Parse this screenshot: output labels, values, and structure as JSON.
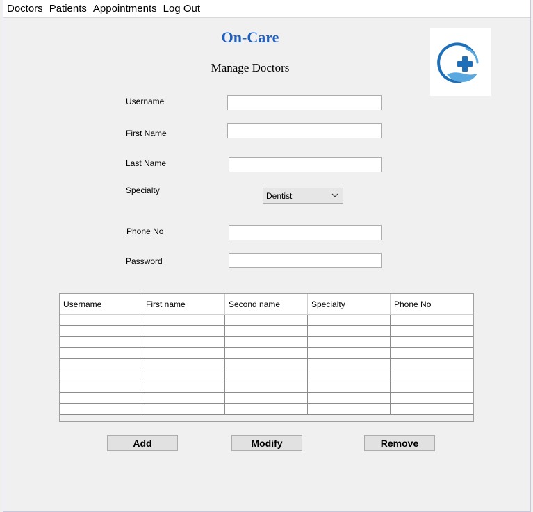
{
  "menu": {
    "items": [
      {
        "label": "Doctors"
      },
      {
        "label": "Patients"
      },
      {
        "label": "Appointments"
      },
      {
        "label": "Log Out"
      }
    ]
  },
  "header": {
    "app_title": "On-Care",
    "page_title": "Manage Doctors"
  },
  "form": {
    "username_label": "Username",
    "username_value": "",
    "first_name_label": "First Name",
    "first_name_value": "",
    "last_name_label": "Last Name",
    "last_name_value": "",
    "specialty_label": "Specialty",
    "specialty_selected": "Dentist",
    "phone_label": "Phone No",
    "phone_value": "",
    "password_label": "Password",
    "password_value": ""
  },
  "table": {
    "columns": [
      "Username",
      "First name",
      "Second name",
      "Specialty",
      "Phone No"
    ],
    "rows": []
  },
  "buttons": {
    "add_label": "Add",
    "modify_label": "Modify",
    "remove_label": "Remove"
  },
  "colors": {
    "app_title": "#1f5fbf",
    "logo_blue": "#1f6fb8",
    "logo_light_blue": "#5aa8e0"
  },
  "icons": {
    "logo": "medical-cross-hand-icon",
    "dropdown": "chevron-down-icon"
  }
}
